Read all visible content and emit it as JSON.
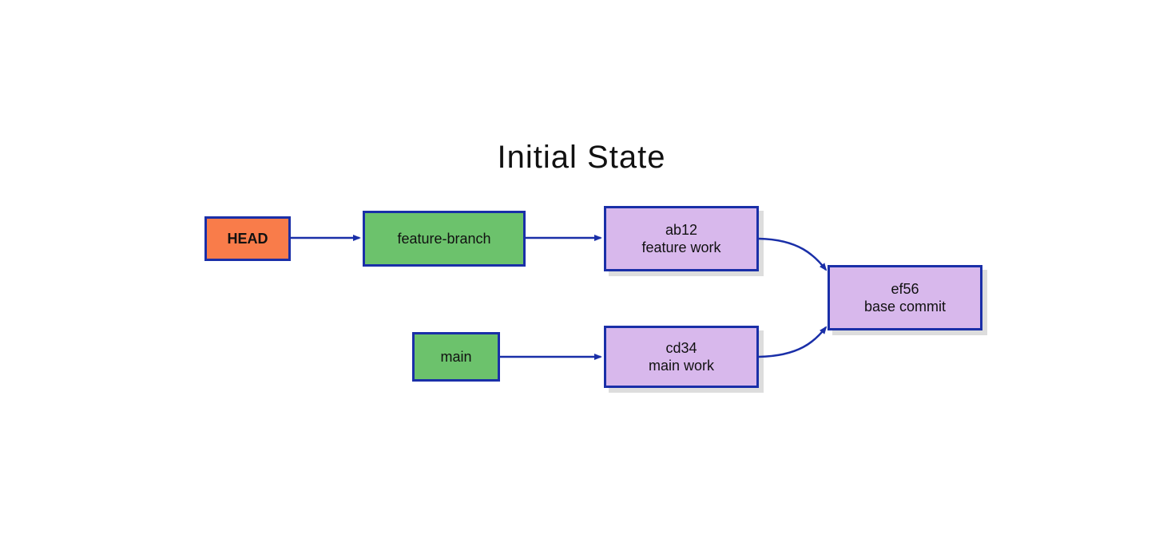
{
  "title": "Initial State",
  "nodes": {
    "head": {
      "label": "HEAD"
    },
    "feature": {
      "label": "feature-branch"
    },
    "main": {
      "label": "main"
    },
    "commit_ab12": {
      "line1": "ab12",
      "line2": "feature work"
    },
    "commit_cd34": {
      "line1": "cd34",
      "line2": "main work"
    },
    "commit_ef56": {
      "line1": "ef56",
      "line2": "base commit"
    }
  },
  "colors": {
    "stroke": "#1a2fa8",
    "orange": "#f97c4a",
    "green": "#6cc26c",
    "purple": "#d8b8ec"
  },
  "arrows": [
    {
      "from": "head",
      "to": "feature"
    },
    {
      "from": "feature",
      "to": "commit_ab12"
    },
    {
      "from": "main",
      "to": "commit_cd34"
    },
    {
      "from": "commit_ab12",
      "to": "commit_ef56"
    },
    {
      "from": "commit_cd34",
      "to": "commit_ef56"
    }
  ]
}
